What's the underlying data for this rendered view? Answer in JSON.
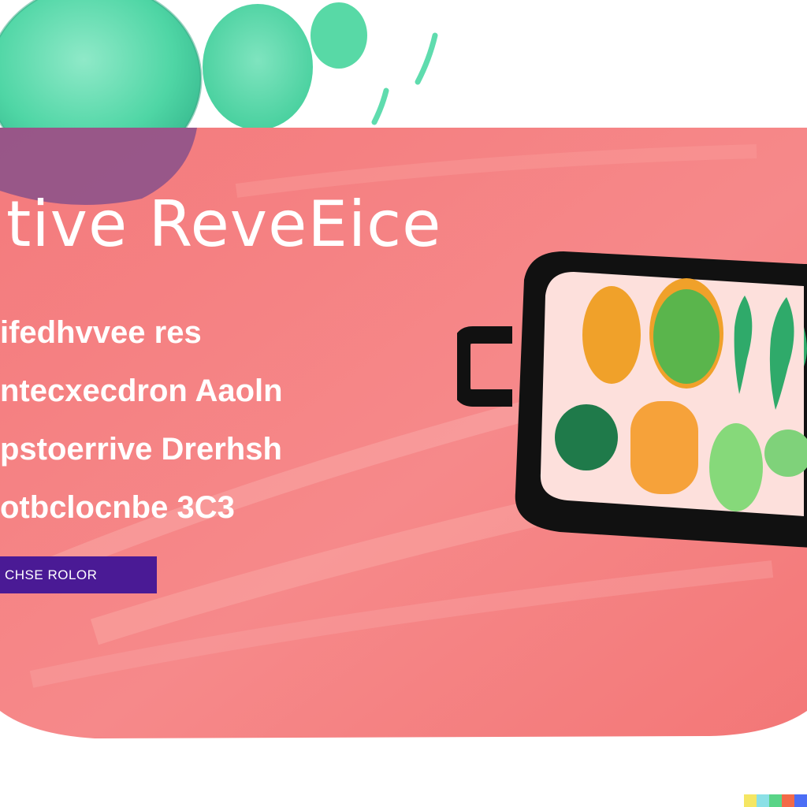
{
  "hero": {
    "title": "tive ReveEice",
    "lines": [
      "ifedhvvee res",
      "ntecxecdron Aaoln",
      "pstoerrive Drerhsh",
      "otbclocnbe 3C3"
    ],
    "button_label": "CHSE ROLOR",
    "colors": {
      "background": "#f47f7f",
      "accent_button": "#4a1a95",
      "bubble_teal": "#56d8a8"
    }
  },
  "illustration": {
    "icons": [
      "bento-box-icon",
      "food-compartment-icon",
      "leaf-icon",
      "paint-blob-icon"
    ]
  },
  "watermark": {
    "colors": [
      "#f5e663",
      "#8be0e6",
      "#59d487",
      "#f36a48",
      "#4c6ef5"
    ]
  }
}
